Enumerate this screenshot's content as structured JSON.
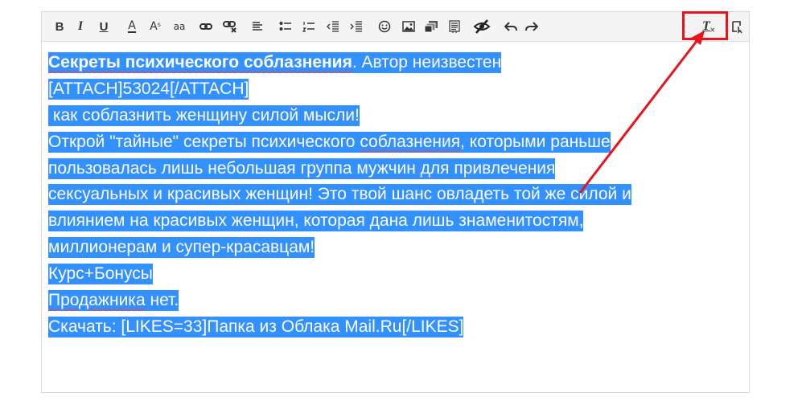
{
  "toolbar": {
    "bold_label": "B",
    "italic_label": "I",
    "underline_label": "U",
    "font_color_label": "A",
    "font_size_label": "A",
    "font_size_sup": "s",
    "font_family_label": "aa",
    "icons": [
      "bold-icon",
      "italic-icon",
      "underline-icon",
      "font-color-icon",
      "font-size-icon",
      "font-family-icon",
      "link-icon",
      "unlink-icon",
      "align-icon",
      "bullet-list-icon",
      "numbered-list-icon",
      "outdent-icon",
      "indent-icon",
      "smiley-icon",
      "image-icon",
      "media-icon",
      "insert-icon",
      "spoiler-icon",
      "undo-icon",
      "redo-icon",
      "remove-format-icon",
      "toggle-mode-icon"
    ],
    "remove_format_label": "T"
  },
  "highlight_color": "#e8141c",
  "selection_color": "#3390ff",
  "content": {
    "line1_bold": "Секреты психического соблазнения",
    "line1_rest": ". Автор неизвестен",
    "line2": "[ATTACH]53024[/ATTACH]",
    "line3": " как соблазнить женщину силой мысли!",
    "line4a": "Открой \"тайные\" секреты психического ",
    "line4b": "соблазнения",
    "line4c": ", которыми раньше",
    "line5": "пользовалась лишь небольшая группа мужчин для привлечения",
    "line6": "сексуальных и красивых женщин! Это твой шанс овладеть той же силой и",
    "line7": "влиянием на красивых женщин, которая дана лишь знаменитостям,",
    "line8": "миллионерам и супер-красавцам!",
    "line9": "Курс+Бонусы",
    "line10a": "Продажника",
    "line10b": " нет.",
    "line11": "Скачать: [LIKES=33]Папка из Облака Mail.Ru[/LIKES]"
  }
}
